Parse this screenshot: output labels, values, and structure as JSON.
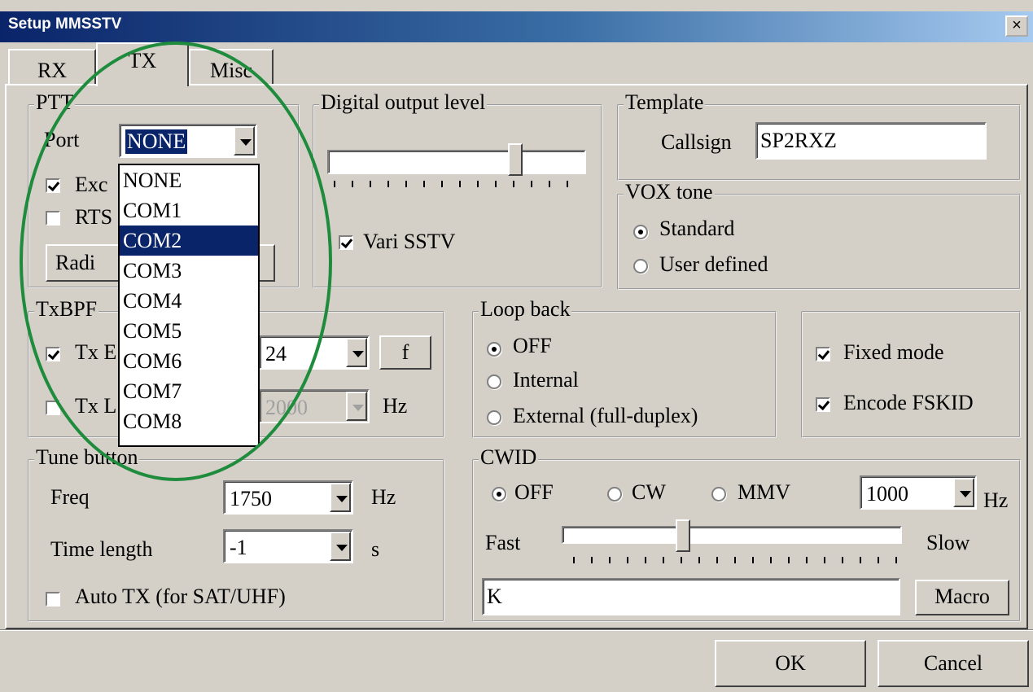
{
  "window": {
    "title": "Setup MMSSTV",
    "close_symbol": "×"
  },
  "tabs": [
    {
      "label": "RX"
    },
    {
      "label": "TX"
    },
    {
      "label": "Misc"
    }
  ],
  "ptt": {
    "group_label": "PTT",
    "port_label": "Port",
    "port_value": "NONE",
    "exclusive_label": "Exc",
    "exclusive_checked": true,
    "rts_label": "RTS",
    "rts_checked": false,
    "radio_button_label": "Radi",
    "port_options": [
      "NONE",
      "COM1",
      "COM2",
      "COM3",
      "COM4",
      "COM5",
      "COM6",
      "COM7",
      "COM8"
    ],
    "port_highlighted": "COM2"
  },
  "digital_output": {
    "group_label": "Digital output level",
    "level_fraction": 0.74,
    "vari_sstv_label": "Vari SSTV",
    "vari_sstv_checked": true
  },
  "template": {
    "group_label": "Template",
    "callsign_label": "Callsign",
    "callsign_value": "SP2RXZ"
  },
  "vox_tone": {
    "group_label": "VOX tone",
    "options": [
      "Standard",
      "User defined"
    ],
    "selected": "Standard"
  },
  "txbpf": {
    "group_label": "TxBPF",
    "row1_label": "Tx E",
    "row1_checked": true,
    "row1_value": "24",
    "f_button": "f",
    "row2_label": "Tx L",
    "row2_checked": false,
    "row2_value": "2000",
    "hz": "Hz"
  },
  "loop_back": {
    "group_label": "Loop back",
    "options": [
      "OFF",
      "Internal",
      "External (full-duplex)"
    ],
    "selected": "OFF"
  },
  "modes": {
    "fixed_mode_label": "Fixed mode",
    "fixed_mode_checked": true,
    "encode_fskid_label": "Encode FSKID",
    "encode_fskid_checked": true
  },
  "tune": {
    "group_label": "Tune button",
    "freq_label": "Freq",
    "freq_value": "1750",
    "freq_unit": "Hz",
    "time_label": "Time length",
    "time_value": "-1",
    "time_unit": "s",
    "auto_tx_label": "Auto TX (for SAT/UHF)",
    "auto_tx_checked": false
  },
  "cwid": {
    "group_label": "CWID",
    "options": [
      "OFF",
      "CW",
      "MMV"
    ],
    "selected": "OFF",
    "freq_value": "1000",
    "freq_unit": "Hz",
    "fast_label": "Fast",
    "slow_label": "Slow",
    "speed_fraction": 0.35,
    "text_value": "K",
    "macro_button": "Macro"
  },
  "footer": {
    "ok": "OK",
    "cancel": "Cancel"
  },
  "colors": {
    "highlight_ellipse": "#1e8c3c",
    "selection": "#0a246a",
    "title_left": "#0a246a"
  }
}
